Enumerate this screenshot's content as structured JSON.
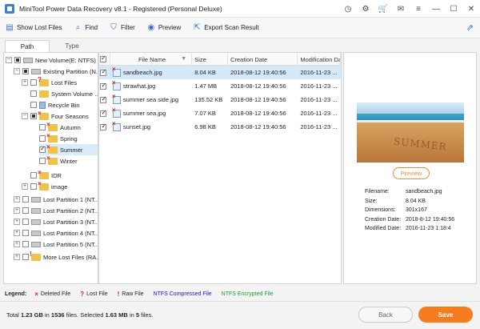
{
  "window": {
    "title": "MiniTool Power Data Recovery v8.1 - Registered (Personal Deluxe)"
  },
  "toolbar": {
    "show_lost_files": "Show Lost Files",
    "find": "Find",
    "filter": "Filter",
    "preview": "Preview",
    "export_scan_result": "Export Scan Result"
  },
  "tabs": [
    "Path",
    "Type"
  ],
  "tree": {
    "root": "New Volume(E: NTFS)",
    "existing_partition": "Existing Partition (N...",
    "lost_files": "Lost Files",
    "system_volume": "System Volume ...",
    "recycle_bin": "Recycle Bin",
    "four_seasons": "Four Seasons",
    "autumn": "Autumn",
    "spring": "Spring",
    "summer": "Summer",
    "winter": "Winter",
    "idr": "IDR",
    "image": "image",
    "lost_partition_1": "Lost Partition 1 (NT...",
    "lost_partition_2": "Lost Partition 2 (NT...",
    "lost_partition_3": "Lost Partition 3 (NT...",
    "lost_partition_4": "Lost Partition 4 (NT...",
    "lost_partition_5": "Lost Partition 5 (NT...",
    "more_lost_files": "More Lost Files (RA..."
  },
  "file_list": {
    "headers": {
      "name": "File Name",
      "size": "Size",
      "creation": "Creation Date",
      "modification": "Modification Dat"
    },
    "rows": [
      {
        "name": "sandbeach.jpg",
        "size": "8.04 KB",
        "created": "2018-08-12 19:40:56",
        "modified": "2016-11-23 ..."
      },
      {
        "name": "strawhat.jpg",
        "size": "1.47 MB",
        "created": "2018-08-12 19:40:56",
        "modified": "2016-11-23 ..."
      },
      {
        "name": "summer sea side.jpg",
        "size": "135.52 KB",
        "created": "2018-08-12 19:40:56",
        "modified": "2016-11-23 ..."
      },
      {
        "name": "summer sea.jpg",
        "size": "7.07 KB",
        "created": "2018-08-12 19:40:56",
        "modified": "2016-11-23 ..."
      },
      {
        "name": "sunset.jpg",
        "size": "6.98 KB",
        "created": "2018-08-12 19:40:56",
        "modified": "2016-11-23 ..."
      }
    ]
  },
  "preview_panel": {
    "thumb_text": "SUMMER",
    "button": "Preview",
    "props": {
      "filename_label": "Filename:",
      "filename": "sandbeach.jpg",
      "size_label": "Size:",
      "size": "8.04 KB",
      "dimensions_label": "Dimensions:",
      "dimensions": "301x167",
      "creation_label": "Creation Date:",
      "creation": "2018-8-12 19:40:56",
      "modified_label": "Modified Date:",
      "modified": "2016-11-23 1:18:4"
    }
  },
  "legend": {
    "label": "Legend:",
    "deleted": "Deleted File",
    "lost": "Lost File",
    "raw": "Raw File",
    "ntfs_compressed": "NTFS Compressed File",
    "ntfs_encrypted": "NTFS Encrypted File",
    "compressed_color": "#1a1ad6",
    "encrypted_color": "#16a03a"
  },
  "footer": {
    "total_prefix": "Total",
    "total_size": "1.23 GB",
    "in": "in",
    "total_files": "1536",
    "files_selected": "files.  Selected",
    "selected_size": "1.63 MB",
    "in2": "in",
    "selected_files": "5",
    "files_end": "files.",
    "back": "Back",
    "save": "Save"
  }
}
